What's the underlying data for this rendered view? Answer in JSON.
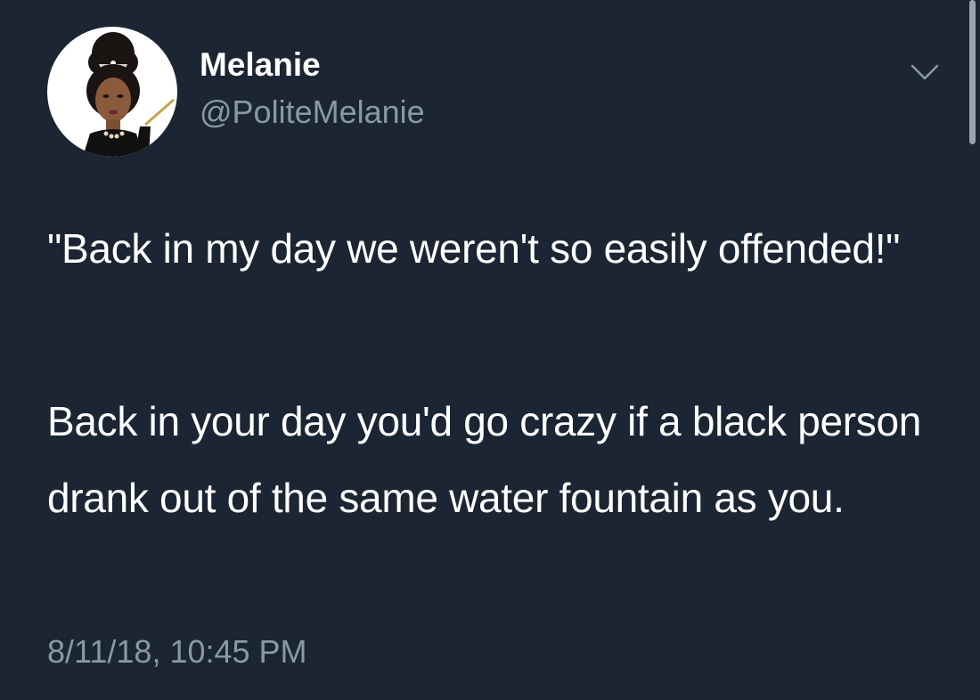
{
  "tweet": {
    "display_name": "Melanie",
    "handle": "@PoliteMelanie",
    "paragraphs": [
      "\"Back in my day we weren't so easily offended!\"",
      "Back in your day you'd go crazy if a black person drank out of the same water fountain as you."
    ],
    "timestamp": "8/11/18, 10:45 PM"
  },
  "icons": {
    "menu": "chevron-down-icon",
    "avatar": "avatar-illustration"
  },
  "colors": {
    "background": "#1c2533",
    "primary_text": "#ffffff",
    "secondary_text": "#8899a6"
  }
}
